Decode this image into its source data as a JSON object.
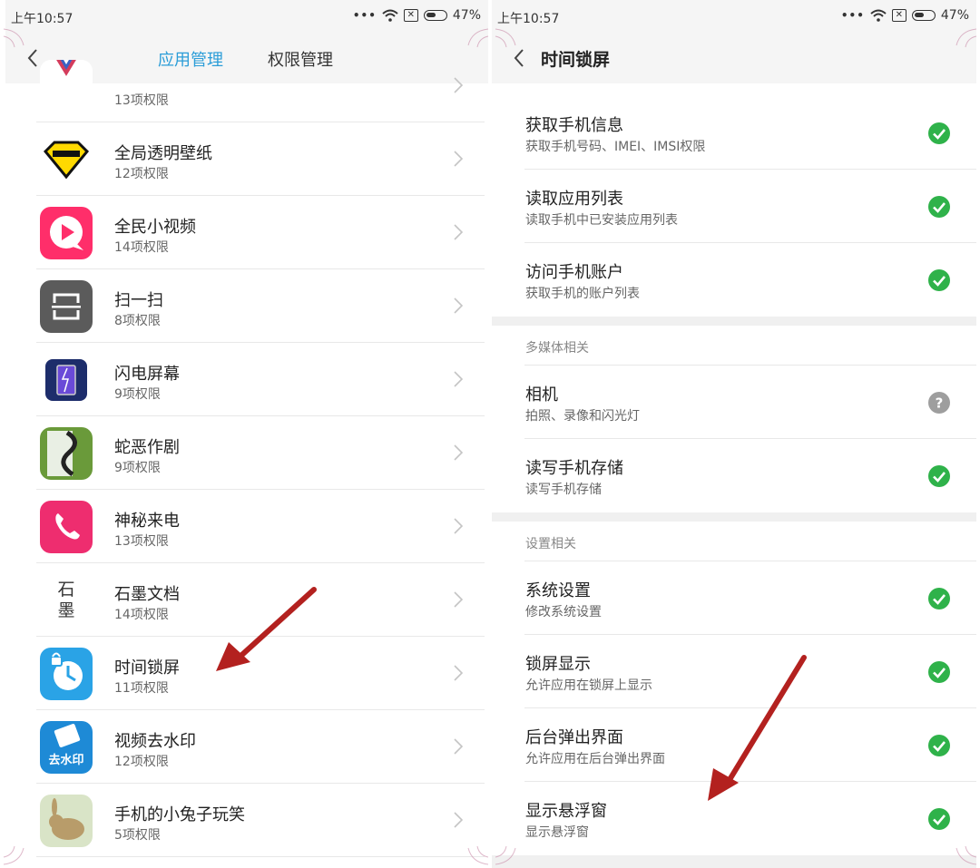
{
  "status_bar": {
    "time": "上午10:57",
    "dots": "•••",
    "battery": "47%"
  },
  "left": {
    "tabs": [
      "应用管理",
      "权限管理"
    ],
    "apps": [
      {
        "name": "",
        "perms": "13项权限",
        "icon": "heart-logo-icon",
        "color": "#ffffff"
      },
      {
        "name": "全局透明壁纸",
        "perms": "12项权限",
        "icon": "diamond-icon",
        "color": "#ffd900"
      },
      {
        "name": "全民小视频",
        "perms": "14项权限",
        "icon": "play-bubble-icon",
        "color": "#ff2e6a"
      },
      {
        "name": "扫一扫",
        "perms": "8项权限",
        "icon": "scan-icon",
        "color": "#5b5b5b"
      },
      {
        "name": "闪电屏幕",
        "perms": "9项权限",
        "icon": "lightning-screen-icon",
        "color": "#1d2d6b"
      },
      {
        "name": "蛇恶作剧",
        "perms": "9项权限",
        "icon": "snake-icon",
        "color": "#6a9a3a"
      },
      {
        "name": "神秘来电",
        "perms": "13项权限",
        "icon": "phone-icon",
        "color": "#ee2d6f"
      },
      {
        "name": "石墨文档",
        "perms": "14项权限",
        "icon": "shimo-icon",
        "color": "#ffffff",
        "glyphs": [
          "石",
          "墨"
        ]
      },
      {
        "name": "时间锁屏",
        "perms": "11项权限",
        "icon": "clock-lock-icon",
        "color": "#2aa3e6"
      },
      {
        "name": "视频去水印",
        "perms": "12项权限",
        "icon": "watermark-icon",
        "color": "#1e8ad6",
        "glyph": "去水印"
      },
      {
        "name": "手机的小兔子玩笑",
        "perms": "5项权限",
        "icon": "rabbit-icon",
        "color": "#b89c6a"
      }
    ]
  },
  "right": {
    "title": "时间锁屏",
    "sections": [
      {
        "header": "",
        "items": [
          {
            "name": "获取手机信息",
            "desc": "获取手机号码、IMEI、IMSI权限",
            "status": "allowed"
          },
          {
            "name": "读取应用列表",
            "desc": "读取手机中已安装应用列表",
            "status": "allowed"
          },
          {
            "name": "访问手机账户",
            "desc": "获取手机的账户列表",
            "status": "allowed"
          }
        ]
      },
      {
        "header": "多媒体相关",
        "items": [
          {
            "name": "相机",
            "desc": "拍照、录像和闪光灯",
            "status": "ask"
          },
          {
            "name": "读写手机存储",
            "desc": "读写手机存储",
            "status": "allowed"
          }
        ]
      },
      {
        "header": "设置相关",
        "items": [
          {
            "name": "系统设置",
            "desc": "修改系统设置",
            "status": "allowed"
          },
          {
            "name": "锁屏显示",
            "desc": "允许应用在锁屏上显示",
            "status": "allowed"
          },
          {
            "name": "后台弹出界面",
            "desc": "允许应用在后台弹出界面",
            "status": "allowed"
          },
          {
            "name": "显示悬浮窗",
            "desc": "显示悬浮窗",
            "status": "allowed"
          }
        ]
      }
    ]
  },
  "colors": {
    "accent": "#2b9dd8",
    "allowed": "#2fb24a",
    "ask": "#9e9e9e",
    "annotation_arrow": "#b3211f"
  }
}
